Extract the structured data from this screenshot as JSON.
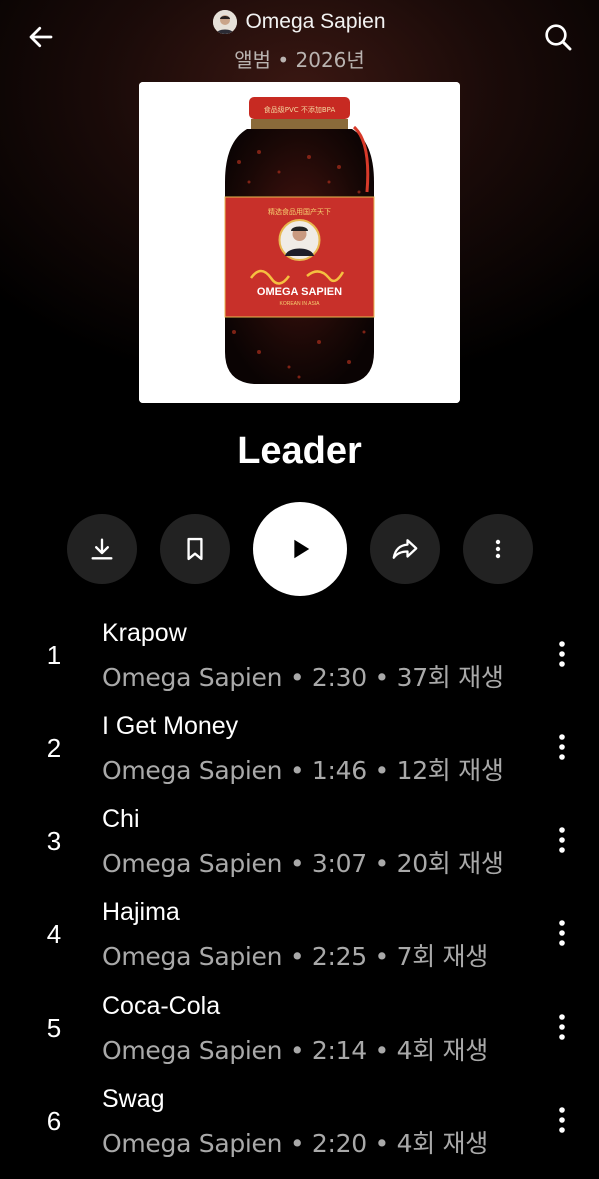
{
  "header": {
    "artist": "Omega Sapien",
    "subtitle": "앨범 • 2026년"
  },
  "album": {
    "title": "Leader",
    "cover_label": {
      "lid_text": "食品级PVC 不添加BPA",
      "top_text": "精选食品用国产天下",
      "brand": "OMEGA SAPIEN",
      "brand_sub": "KOREAN IN ASIA"
    }
  },
  "actions": {
    "download": "download-icon",
    "save": "bookmark-icon",
    "play": "play-icon",
    "share": "share-icon",
    "more": "more-vertical-icon"
  },
  "tracks": [
    {
      "num": "1",
      "title": "Krapow",
      "meta": "Omega Sapien • 2:30 • 37회 재생"
    },
    {
      "num": "2",
      "title": "I Get Money",
      "meta": "Omega Sapien • 1:46 • 12회 재생"
    },
    {
      "num": "3",
      "title": "Chi",
      "meta": "Omega Sapien • 3:07 • 20회 재생"
    },
    {
      "num": "4",
      "title": "Hajima",
      "meta": "Omega Sapien • 2:25 • 7회 재생"
    },
    {
      "num": "5",
      "title": "Coca-Cola",
      "meta": "Omega Sapien • 2:14 • 4회 재생"
    },
    {
      "num": "6",
      "title": "Swag",
      "meta": "Omega Sapien • 2:20 • 4회 재생"
    }
  ]
}
